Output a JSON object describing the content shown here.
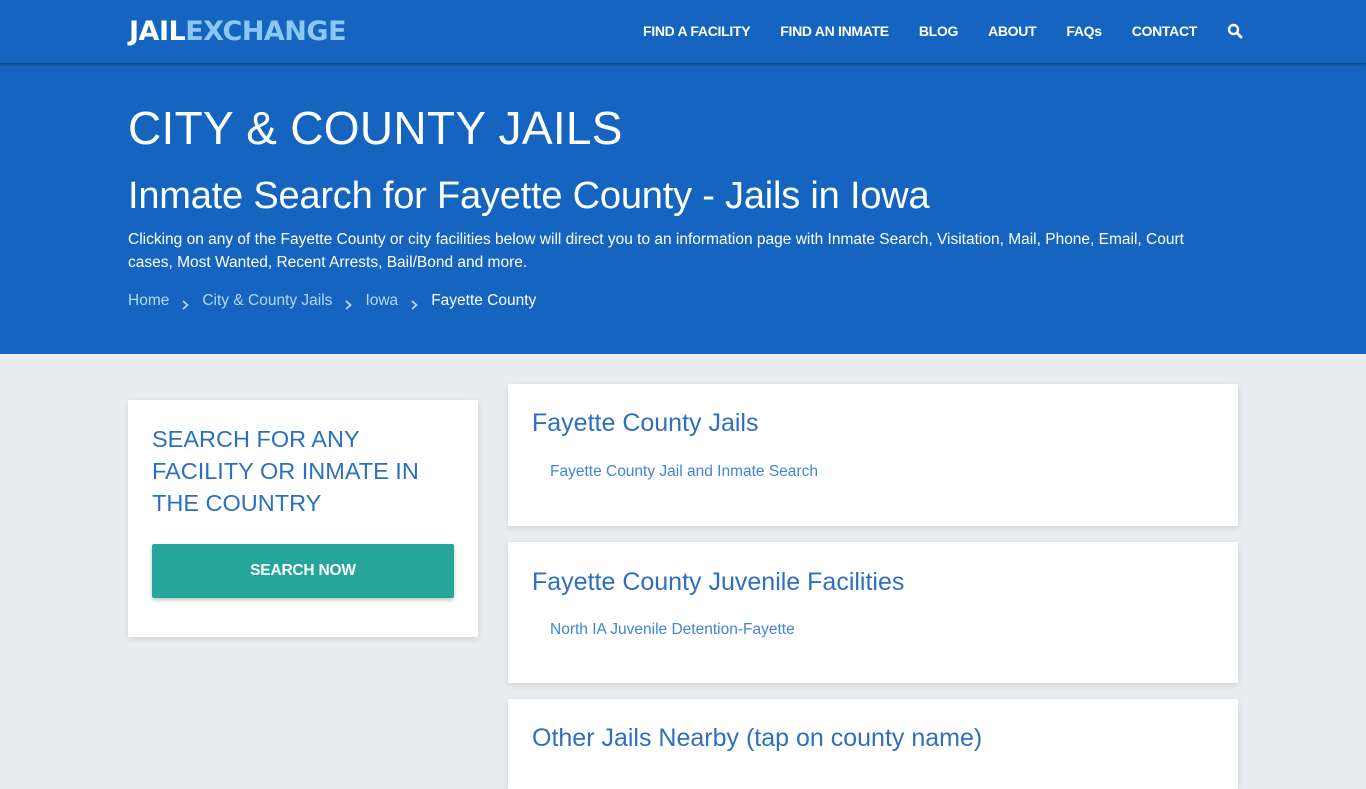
{
  "header": {
    "logo_part1": "JAIL",
    "logo_part2": "EXCHANGE",
    "nav": [
      {
        "label": "FIND A FACILITY"
      },
      {
        "label": "FIND AN INMATE"
      },
      {
        "label": "BLOG"
      },
      {
        "label": "ABOUT"
      },
      {
        "label": "FAQs"
      },
      {
        "label": "CONTACT"
      }
    ],
    "search_icon": "search-icon"
  },
  "hero": {
    "title": "CITY & COUNTY JAILS",
    "subtitle": "Inmate Search for Fayette County - Jails in Iowa",
    "description": "Clicking on any of the Fayette County or city facilities below will direct you to an information page with Inmate Search, Visitation, Mail, Phone, Email, Court cases, Most Wanted, Recent Arrests, Bail/Bond and more.",
    "breadcrumb": [
      {
        "label": "Home"
      },
      {
        "label": "City & County Jails"
      },
      {
        "label": "Iowa"
      },
      {
        "label": "Fayette County"
      }
    ]
  },
  "sidebar": {
    "title": "SEARCH FOR ANY FACILITY OR INMATE IN THE COUNTRY",
    "button_label": "SEARCH NOW"
  },
  "main": {
    "sections": [
      {
        "title": "Fayette County Jails",
        "links": [
          "Fayette County Jail and Inmate Search"
        ]
      },
      {
        "title": "Fayette County Juvenile Facilities",
        "links": [
          "North IA Juvenile Detention-Fayette"
        ]
      },
      {
        "title": "Other Jails Nearby (tap on county name)",
        "links": []
      }
    ]
  },
  "colors": {
    "brand_blue": "#1565c0",
    "logo_accent": "#8cc8f5",
    "heading_blue": "#2f6fbf",
    "link_blue": "#3f86d4",
    "button_teal": "#26a69a",
    "page_bg": "#e9edf0"
  }
}
